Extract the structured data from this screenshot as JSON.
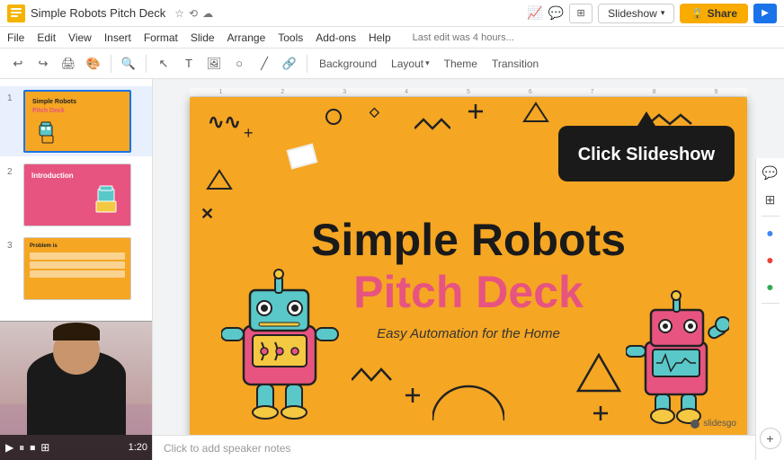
{
  "titlebar": {
    "title": "Simple Robots Pitch Deck",
    "star_icon": "☆",
    "history_icon": "⟲",
    "cloud_icon": "☁",
    "analytics_icon": "∿",
    "comment_icon": "💬",
    "apps_label": "⊞",
    "slideshow_label": "Slideshow",
    "slideshow_arrow": "▾",
    "share_label": "Share",
    "meet_icon": "▶"
  },
  "menubar": {
    "items": [
      "File",
      "Edit",
      "View",
      "Insert",
      "Format",
      "Slide",
      "Arrange",
      "Tools",
      "Add-ons",
      "Help"
    ],
    "last_edit": "Last edit was 4 hours..."
  },
  "toolbar": {
    "undo": "↩",
    "redo": "↪",
    "print": "🖨",
    "paint": "🎨",
    "zoom": "🔍",
    "cursor": "↖",
    "textbox": "T",
    "image": "🖼",
    "shape": "○",
    "line": "╱",
    "link": "🔗",
    "background_label": "Background",
    "layout_label": "Layout",
    "layout_arrow": "▾",
    "theme_label": "Theme",
    "transition_label": "Transition"
  },
  "slides": [
    {
      "num": "1",
      "active": true
    },
    {
      "num": "2",
      "active": false
    },
    {
      "num": "3",
      "active": false
    }
  ],
  "slide_main": {
    "title_line1": "Simple Robots",
    "title_line2": "Pitch Deck",
    "tagline": "Easy Automation for the Home",
    "slidesgo": "slidesgo"
  },
  "tooltip": {
    "text": "Click Slideshow"
  },
  "notes_bar": {
    "placeholder": "Click to add speaker notes"
  },
  "right_panel": {
    "comments_icon": "💬",
    "slides_icon": "⊞",
    "explore_icon": "🔍",
    "account_icon": "👤",
    "maps_icon": "📍",
    "add_icon": "+"
  },
  "webcam": {
    "play_icon": "▶",
    "pause_icon": "⏸",
    "stop_icon": "⏹",
    "grid_icon": "⊞",
    "time": "1:20"
  }
}
